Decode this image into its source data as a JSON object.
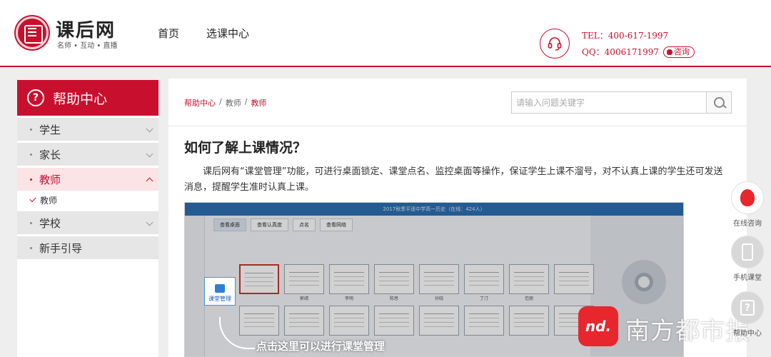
{
  "header": {
    "logo_name": "课后网",
    "logo_slogan": "名师 • 互动 • 直播",
    "nav": [
      "首页",
      "选课中心"
    ],
    "tel": "TEL：400-617-1997",
    "qq": "QQ：4006171997",
    "consult_label": "咨询"
  },
  "sidebar": {
    "title": "帮助中心",
    "items": [
      {
        "label": "学生"
      },
      {
        "label": "家长"
      },
      {
        "label": "教师"
      },
      {
        "label": "学校"
      },
      {
        "label": "新手引导"
      }
    ],
    "sub_item": "教师"
  },
  "breadcrumb": {
    "root": "帮助中心",
    "sep": "/",
    "mid": "教师",
    "current": "教师"
  },
  "search": {
    "placeholder": "请输入问题关键字"
  },
  "article": {
    "title": "如何了解上课情况？",
    "body": "课后网有“课堂管理”功能，可进行桌面锁定、课堂点名、监控桌面等操作，保证学生上课不溜号，对不认真上课的学生还可发送消息，提醒学生准时认真上课。"
  },
  "screenshot": {
    "titlebar": "2017秋季平遥中学高一历史（在线：424人）",
    "tabs": [
      "查看桌面",
      "查看认真度",
      "点名",
      "查看网络"
    ],
    "badge_label": "课堂管理",
    "caption": "点击这里可以进行课堂管理",
    "thumb_labels": [
      "",
      "郭靖",
      "李明",
      "陈思",
      "孙晓",
      "丁汀",
      "范丽",
      "",
      "",
      "",
      "",
      "",
      "",
      "",
      "",
      ""
    ]
  },
  "watermark": {
    "logo": "nd.",
    "text": "南方都市报"
  },
  "float": {
    "online": "在线咨询",
    "mobile": "手机课堂",
    "help": "帮助中心"
  },
  "colors": {
    "brand": "#c8102e"
  }
}
